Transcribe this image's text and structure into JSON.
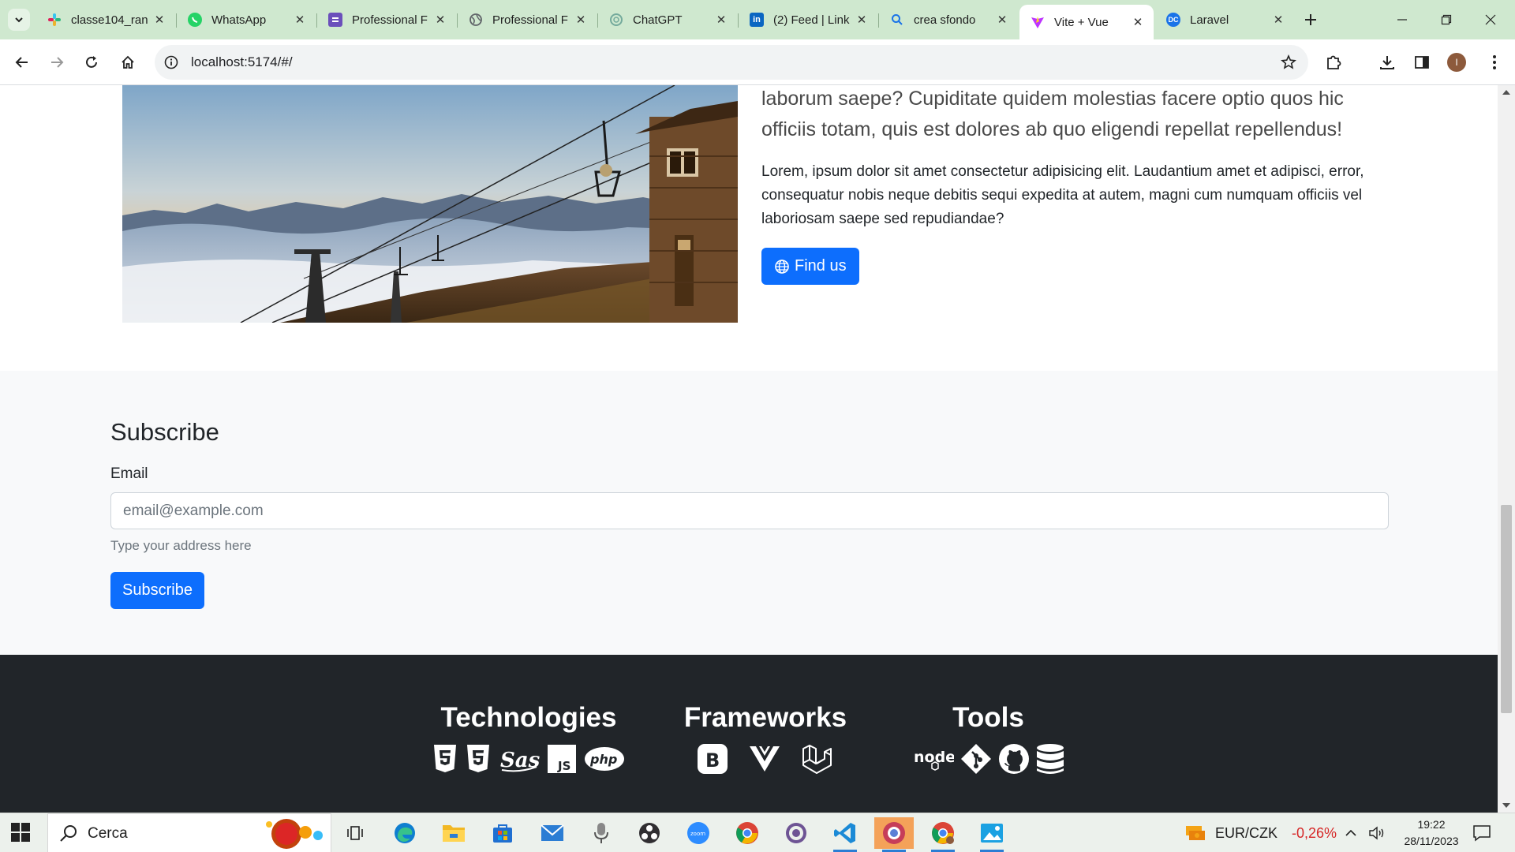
{
  "browser": {
    "tabs": [
      {
        "label": "classe104_ran",
        "icon": "slack-icon",
        "color": "#e01e5a"
      },
      {
        "label": "WhatsApp",
        "icon": "whatsapp-icon",
        "color": "#25d366"
      },
      {
        "label": "Professional F",
        "icon": "document-icon",
        "color": "#6b4fbb"
      },
      {
        "label": "Professional F",
        "icon": "globe-icon",
        "color": "#5f6368"
      },
      {
        "label": "ChatGPT",
        "icon": "chatgpt-icon",
        "color": "#74aa9c"
      },
      {
        "label": "(2) Feed | Link",
        "icon": "linkedin-icon",
        "color": "#0a66c2"
      },
      {
        "label": "crea sfondo",
        "icon": "search-icon",
        "color": "#1a73e8"
      },
      {
        "label": "Vite + Vue",
        "icon": "vite-icon",
        "color": "#bd34fe",
        "active": true
      },
      {
        "label": "Laravel",
        "icon": "dc-icon",
        "color": "#1a73e8"
      }
    ],
    "url": "localhost:5174/#/"
  },
  "page": {
    "hero": {
      "lead": "laborum saepe? Cupiditate quidem molestias facere optio quos hic officiis totam, quis est dolores ab quo eligendi repellat repellendus!",
      "paragraph": "Lorem, ipsum dolor sit amet consectetur adipisicing elit. Laudantium amet et adipisci, error, consequatur nobis neque debitis sequi expedita at autem, magni cum numquam officiis vel laboriosam saepe sed repudiandae?",
      "button_label": "Find us"
    },
    "subscribe": {
      "title": "Subscribe",
      "email_label": "Email",
      "email_placeholder": "email@example.com",
      "email_value": "",
      "help_text": "Type your address here",
      "button_label": "Subscribe"
    },
    "footer": {
      "columns": [
        {
          "title": "Technologies",
          "icons": [
            "html5-icon",
            "css3-icon",
            "sass-icon",
            "javascript-icon",
            "php-icon"
          ]
        },
        {
          "title": "Frameworks",
          "icons": [
            "bootstrap-icon",
            "vue-icon",
            "laravel-icon"
          ]
        },
        {
          "title": "Tools",
          "icons": [
            "nodejs-icon",
            "git-icon",
            "github-icon",
            "database-icon"
          ]
        }
      ]
    },
    "colors": {
      "primary": "#0d6efd",
      "footer_bg": "#212529",
      "section_bg": "#f8f9fa"
    }
  },
  "taskbar": {
    "search_label": "Cerca",
    "apps": [
      "task-view-icon",
      "edge-icon",
      "file-explorer-icon",
      "store-icon",
      "mail-icon",
      "podcast-icon",
      "obs-icon",
      "zoom-icon",
      "chrome-icon",
      "github-desktop-icon",
      "vscode-icon",
      "chrome-canary-icon",
      "chrome-profile-icon",
      "photos-icon"
    ],
    "ticker": {
      "pair": "EUR/CZK",
      "change": "-0,26%"
    },
    "time": "19:22",
    "date": "28/11/2023"
  }
}
